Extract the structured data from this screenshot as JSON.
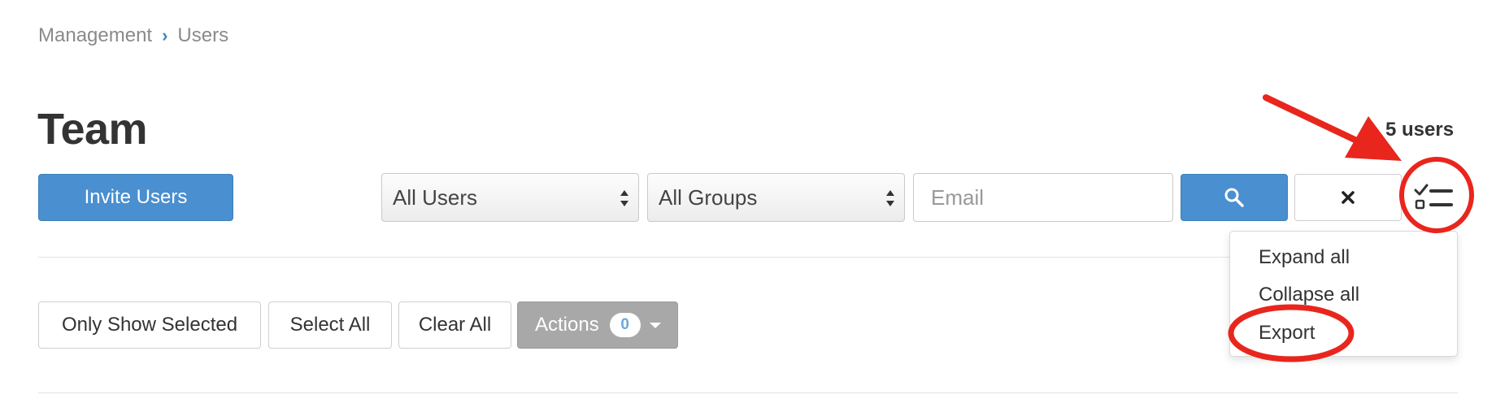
{
  "breadcrumb": {
    "parent": "Management",
    "current": "Users"
  },
  "page_title": "Team",
  "user_count": "5 users",
  "toolbar": {
    "invite_label": "Invite Users",
    "user_filter": {
      "selected": "All Users"
    },
    "group_filter": {
      "selected": "All Groups"
    },
    "email_placeholder": "Email",
    "search_icon": "search-icon",
    "clear_icon": "close-icon",
    "options_icon": "checklist-icon"
  },
  "options_menu": {
    "items": [
      "Expand all",
      "Collapse all",
      "Export"
    ]
  },
  "selection_bar": {
    "only_show_selected": "Only Show Selected",
    "select_all": "Select All",
    "clear_all": "Clear All",
    "actions_label": "Actions",
    "actions_count": "0"
  },
  "colors": {
    "primary": "#4a8fcf",
    "annotation": "#e8261d",
    "actions_disabled": "#a8a8a8"
  }
}
